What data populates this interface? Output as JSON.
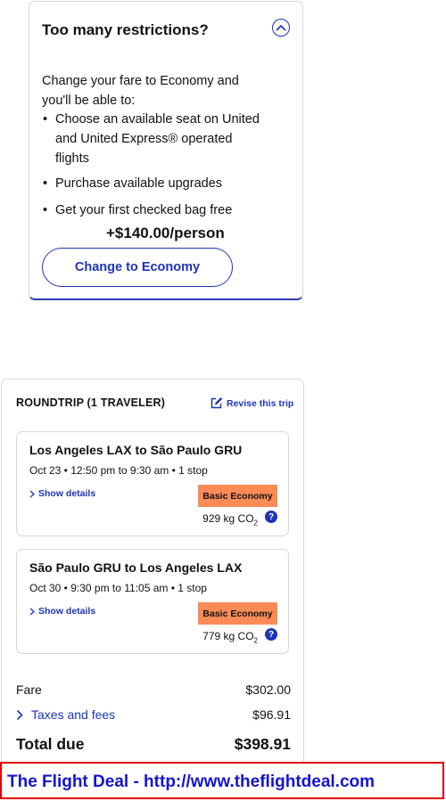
{
  "upsell": {
    "title": "Too many restrictions?",
    "intro": "Change your fare to Economy and you'll be able to:",
    "benefits": [
      "Choose an available seat on United and United Express® operated flights",
      "Purchase available upgrades",
      "Get your first checked bag free"
    ],
    "price": "+$140.00/person",
    "button_label": "Change to Economy"
  },
  "trip": {
    "heading": "ROUNDTRIP (1 TRAVELER)",
    "revise_label": "Revise this trip",
    "flights": [
      {
        "route": "Los Angeles LAX to São Paulo GRU",
        "schedule": "Oct 23 • 12:50 pm to 9:30 am • 1 stop",
        "details_label": "Show details",
        "fare_class": "Basic Economy",
        "co2_value": "929 kg CO",
        "co2_sub": "2",
        "help": "?"
      },
      {
        "route": "São Paulo GRU to Los Angeles LAX",
        "schedule": "Oct 30 • 9:30 pm to 11:05 am • 1 stop",
        "details_label": "Show details",
        "fare_class": "Basic Economy",
        "co2_value": "779 kg CO",
        "co2_sub": "2",
        "help": "?"
      }
    ],
    "costs": {
      "fare_label": "Fare",
      "fare_value": "$302.00",
      "taxes_label": "Taxes and fees",
      "taxes_value": "$96.91",
      "total_label": "Total due",
      "total_value": "$398.91"
    }
  },
  "banner": {
    "text": "The Flight Deal - http://www.theflightdeal.com"
  },
  "colors": {
    "accent": "#1d34b5",
    "fare_badge": "#fa8b57",
    "banner_border": "#e00000",
    "banner_text": "#1414cc"
  },
  "icons": [
    "chevron-up-icon",
    "edit-icon",
    "chevron-right-icon",
    "help-icon"
  ]
}
